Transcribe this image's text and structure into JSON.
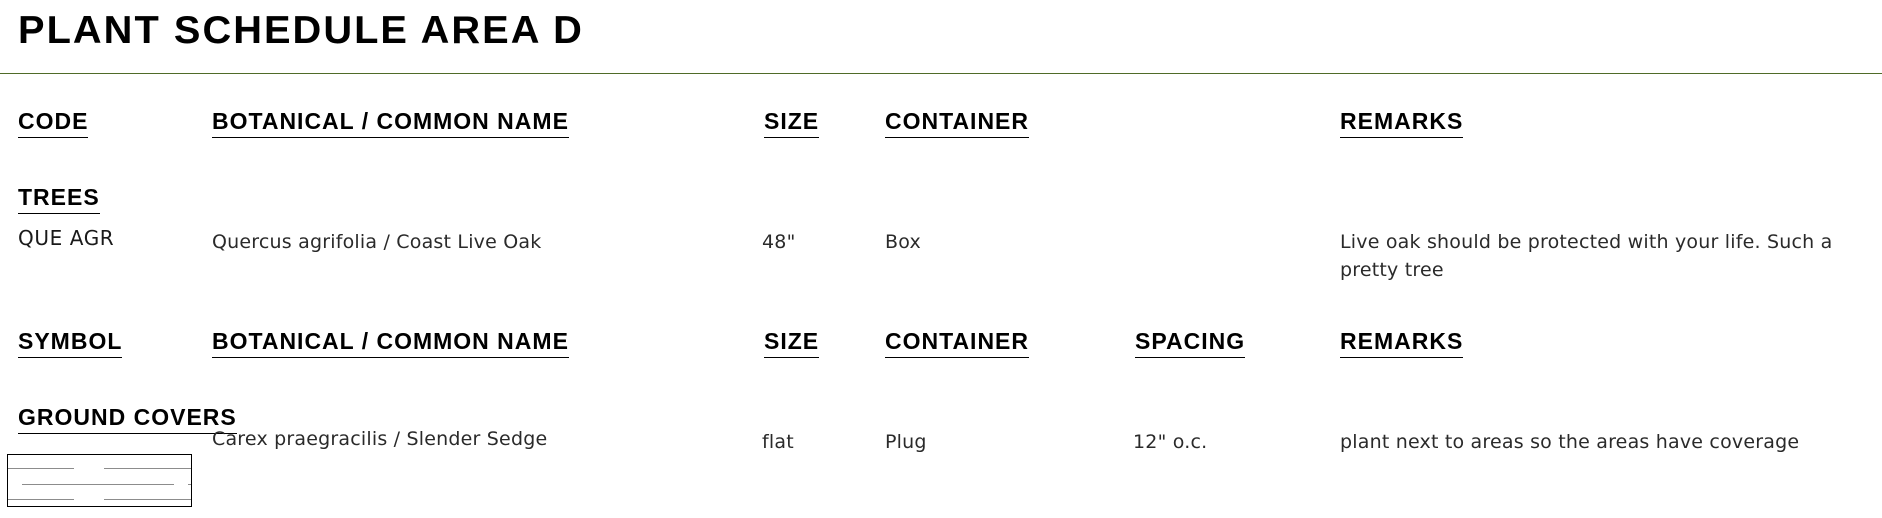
{
  "document": {
    "title": "PLANT SCHEDULE AREA D",
    "rule_color": "#4f6b28",
    "text_color": "#111111"
  },
  "tree_table": {
    "headers": {
      "code": "CODE",
      "botanical": "BOTANICAL / COMMON NAME",
      "size": "SIZE",
      "container": "CONTAINER",
      "remarks": "REMARKS"
    },
    "section_label": "TREES",
    "rows": [
      {
        "code": "QUE AGR",
        "botanical": "Quercus agrifolia / Coast Live Oak",
        "size": "48\"",
        "container": "Box",
        "remarks": "Live oak should be protected with your life. Such a pretty tree"
      }
    ]
  },
  "groundcover_table": {
    "headers": {
      "symbol": "SYMBOL",
      "botanical": "BOTANICAL / COMMON NAME",
      "size": "SIZE",
      "container": "CONTAINER",
      "spacing": "SPACING",
      "remarks": "REMARKS"
    },
    "section_label": "GROUND COVERS",
    "rows": [
      {
        "symbol": "hatched-rectangle-swatch",
        "botanical": "Carex praegracilis / Slender Sedge",
        "size": "flat",
        "container": "Plug",
        "spacing": "12\" o.c.",
        "remarks": "plant next to areas so the areas have coverage"
      }
    ]
  }
}
